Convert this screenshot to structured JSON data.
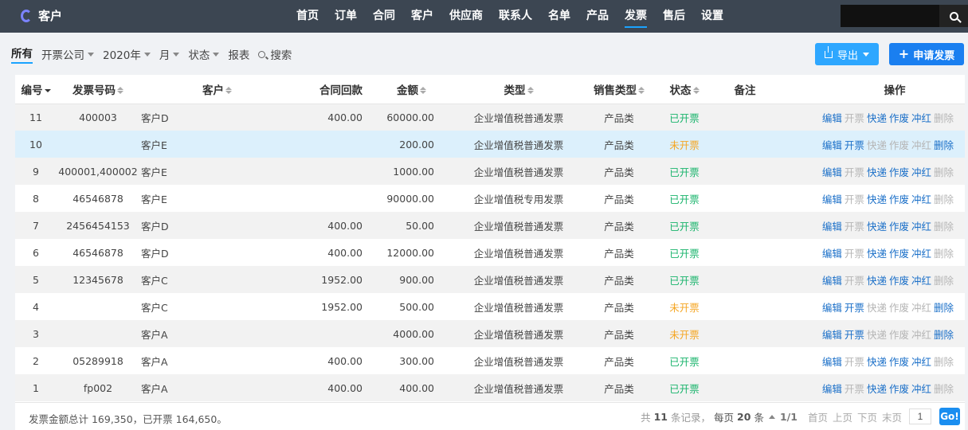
{
  "app": {
    "title": "客户"
  },
  "nav": [
    {
      "label": "首页"
    },
    {
      "label": "订单"
    },
    {
      "label": "合同"
    },
    {
      "label": "客户"
    },
    {
      "label": "供应商"
    },
    {
      "label": "联系人"
    },
    {
      "label": "名单"
    },
    {
      "label": "产品"
    },
    {
      "label": "发票",
      "active": true
    },
    {
      "label": "售后"
    },
    {
      "label": "设置"
    }
  ],
  "search": {
    "placeholder": ""
  },
  "filters": {
    "all": "所有",
    "company": "开票公司",
    "year": "2020年",
    "month": "月",
    "status": "状态",
    "report": "报表",
    "search": "搜索"
  },
  "buttons": {
    "export": "导出",
    "apply": "申请发票"
  },
  "table": {
    "headers": {
      "id": "编号",
      "invoice_no": "发票号码",
      "customer": "客户",
      "payback": "合同回款",
      "amount": "金额",
      "type": "类型",
      "sales_type": "销售类型",
      "status": "状态",
      "remark": "备注",
      "ops": "操作"
    },
    "rows": [
      {
        "id": "11",
        "invoice_no": "400003",
        "customer": "客户D",
        "payback": "400.00",
        "amount": "60000.00",
        "type": "企业增值税普通发票",
        "sales_type": "产品类",
        "status": "已开票",
        "status_kind": "done",
        "remark": "",
        "ops": [
          [
            "编辑",
            1
          ],
          [
            "开票",
            0
          ],
          [
            "快递",
            1
          ],
          [
            "作废",
            1
          ],
          [
            "冲红",
            1
          ],
          [
            "删除",
            0
          ]
        ]
      },
      {
        "id": "10",
        "invoice_no": "",
        "customer": "客户E",
        "payback": "",
        "amount": "200.00",
        "type": "企业增值税普通发票",
        "sales_type": "产品类",
        "status": "未开票",
        "status_kind": "pending",
        "remark": "",
        "ops": [
          [
            "编辑",
            1
          ],
          [
            "开票",
            1
          ],
          [
            "快递",
            0
          ],
          [
            "作废",
            0
          ],
          [
            "冲红",
            0
          ],
          [
            "删除",
            1
          ]
        ]
      },
      {
        "id": "9",
        "invoice_no": "400001,400002",
        "customer": "客户E",
        "payback": "",
        "amount": "1000.00",
        "type": "企业增值税普通发票",
        "sales_type": "产品类",
        "status": "已开票",
        "status_kind": "done",
        "remark": "",
        "ops": [
          [
            "编辑",
            1
          ],
          [
            "开票",
            0
          ],
          [
            "快递",
            1
          ],
          [
            "作废",
            1
          ],
          [
            "冲红",
            1
          ],
          [
            "删除",
            0
          ]
        ]
      },
      {
        "id": "8",
        "invoice_no": "46546878",
        "customer": "客户E",
        "payback": "",
        "amount": "90000.00",
        "type": "企业增值税专用发票",
        "sales_type": "产品类",
        "status": "已开票",
        "status_kind": "done",
        "remark": "",
        "ops": [
          [
            "编辑",
            1
          ],
          [
            "开票",
            0
          ],
          [
            "快递",
            1
          ],
          [
            "作废",
            1
          ],
          [
            "冲红",
            1
          ],
          [
            "删除",
            0
          ]
        ]
      },
      {
        "id": "7",
        "invoice_no": "2456454153",
        "customer": "客户D",
        "payback": "400.00",
        "amount": "50.00",
        "type": "企业增值税普通发票",
        "sales_type": "产品类",
        "status": "已开票",
        "status_kind": "done",
        "remark": "",
        "ops": [
          [
            "编辑",
            1
          ],
          [
            "开票",
            0
          ],
          [
            "快递",
            1
          ],
          [
            "作废",
            1
          ],
          [
            "冲红",
            1
          ],
          [
            "删除",
            0
          ]
        ]
      },
      {
        "id": "6",
        "invoice_no": "46546878",
        "customer": "客户D",
        "payback": "400.00",
        "amount": "12000.00",
        "type": "企业增值税普通发票",
        "sales_type": "产品类",
        "status": "已开票",
        "status_kind": "done",
        "remark": "",
        "ops": [
          [
            "编辑",
            1
          ],
          [
            "开票",
            0
          ],
          [
            "快递",
            1
          ],
          [
            "作废",
            1
          ],
          [
            "冲红",
            1
          ],
          [
            "删除",
            0
          ]
        ]
      },
      {
        "id": "5",
        "invoice_no": "12345678",
        "customer": "客户C",
        "payback": "1952.00",
        "amount": "900.00",
        "type": "企业增值税普通发票",
        "sales_type": "产品类",
        "status": "已开票",
        "status_kind": "done",
        "remark": "",
        "ops": [
          [
            "编辑",
            1
          ],
          [
            "开票",
            0
          ],
          [
            "快递",
            1
          ],
          [
            "作废",
            1
          ],
          [
            "冲红",
            1
          ],
          [
            "删除",
            0
          ]
        ]
      },
      {
        "id": "4",
        "invoice_no": "",
        "customer": "客户C",
        "payback": "1952.00",
        "amount": "500.00",
        "type": "企业增值税普通发票",
        "sales_type": "产品类",
        "status": "未开票",
        "status_kind": "pending",
        "remark": "",
        "ops": [
          [
            "编辑",
            1
          ],
          [
            "开票",
            1
          ],
          [
            "快递",
            0
          ],
          [
            "作废",
            0
          ],
          [
            "冲红",
            0
          ],
          [
            "删除",
            1
          ]
        ]
      },
      {
        "id": "3",
        "invoice_no": "",
        "customer": "客户A",
        "payback": "",
        "amount": "4000.00",
        "type": "企业增值税普通发票",
        "sales_type": "产品类",
        "status": "未开票",
        "status_kind": "pending",
        "remark": "",
        "ops": [
          [
            "编辑",
            1
          ],
          [
            "开票",
            1
          ],
          [
            "快递",
            0
          ],
          [
            "作废",
            0
          ],
          [
            "冲红",
            0
          ],
          [
            "删除",
            1
          ]
        ]
      },
      {
        "id": "2",
        "invoice_no": "05289918",
        "customer": "客户A",
        "payback": "400.00",
        "amount": "300.00",
        "type": "企业增值税普通发票",
        "sales_type": "产品类",
        "status": "已开票",
        "status_kind": "done",
        "remark": "",
        "ops": [
          [
            "编辑",
            1
          ],
          [
            "开票",
            0
          ],
          [
            "快递",
            1
          ],
          [
            "作废",
            1
          ],
          [
            "冲红",
            1
          ],
          [
            "删除",
            0
          ]
        ]
      },
      {
        "id": "1",
        "invoice_no": "fp002",
        "customer": "客户A",
        "payback": "400.00",
        "amount": "400.00",
        "type": "企业增值税普通发票",
        "sales_type": "产品类",
        "status": "已开票",
        "status_kind": "done",
        "remark": "",
        "ops": [
          [
            "编辑",
            1
          ],
          [
            "开票",
            0
          ],
          [
            "快递",
            1
          ],
          [
            "作废",
            1
          ],
          [
            "冲红",
            1
          ],
          [
            "删除",
            0
          ]
        ]
      }
    ]
  },
  "footer": {
    "summary": "发票金额总计 169,350，已开票 164,650。",
    "total_prefix": "共",
    "total_count": "11",
    "total_suffix": "条记录，",
    "per_page_prefix": "每页",
    "per_page": "20",
    "per_page_suffix": "条",
    "page_info": "1/1",
    "first": "首页",
    "prev": "上页",
    "next": "下页",
    "last": "末页",
    "page_input": "1",
    "go": "Go!"
  },
  "colors": {
    "topbar": "#3c4652",
    "accent": "#1aa3ff",
    "done": "#1ab46c",
    "pending": "#f5a623",
    "link": "#1a6fc8"
  }
}
